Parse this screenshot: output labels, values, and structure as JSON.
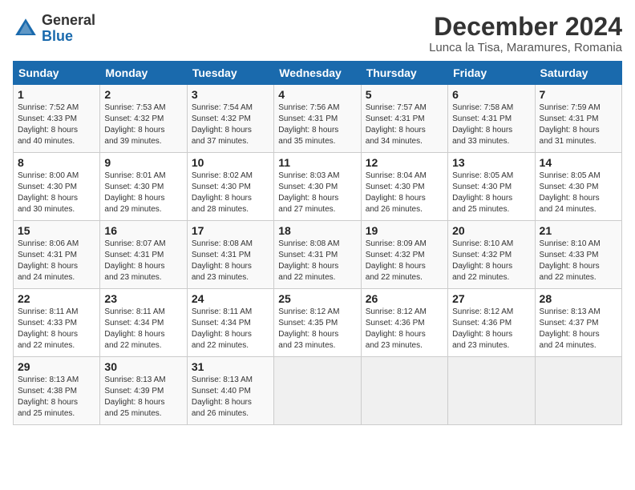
{
  "logo": {
    "general": "General",
    "blue": "Blue"
  },
  "title": "December 2024",
  "location": "Lunca la Tisa, Maramures, Romania",
  "days_of_week": [
    "Sunday",
    "Monday",
    "Tuesday",
    "Wednesday",
    "Thursday",
    "Friday",
    "Saturday"
  ],
  "weeks": [
    [
      {
        "day": "1",
        "info": "Sunrise: 7:52 AM\nSunset: 4:33 PM\nDaylight: 8 hours\nand 40 minutes."
      },
      {
        "day": "2",
        "info": "Sunrise: 7:53 AM\nSunset: 4:32 PM\nDaylight: 8 hours\nand 39 minutes."
      },
      {
        "day": "3",
        "info": "Sunrise: 7:54 AM\nSunset: 4:32 PM\nDaylight: 8 hours\nand 37 minutes."
      },
      {
        "day": "4",
        "info": "Sunrise: 7:56 AM\nSunset: 4:31 PM\nDaylight: 8 hours\nand 35 minutes."
      },
      {
        "day": "5",
        "info": "Sunrise: 7:57 AM\nSunset: 4:31 PM\nDaylight: 8 hours\nand 34 minutes."
      },
      {
        "day": "6",
        "info": "Sunrise: 7:58 AM\nSunset: 4:31 PM\nDaylight: 8 hours\nand 33 minutes."
      },
      {
        "day": "7",
        "info": "Sunrise: 7:59 AM\nSunset: 4:31 PM\nDaylight: 8 hours\nand 31 minutes."
      }
    ],
    [
      {
        "day": "8",
        "info": "Sunrise: 8:00 AM\nSunset: 4:30 PM\nDaylight: 8 hours\nand 30 minutes."
      },
      {
        "day": "9",
        "info": "Sunrise: 8:01 AM\nSunset: 4:30 PM\nDaylight: 8 hours\nand 29 minutes."
      },
      {
        "day": "10",
        "info": "Sunrise: 8:02 AM\nSunset: 4:30 PM\nDaylight: 8 hours\nand 28 minutes."
      },
      {
        "day": "11",
        "info": "Sunrise: 8:03 AM\nSunset: 4:30 PM\nDaylight: 8 hours\nand 27 minutes."
      },
      {
        "day": "12",
        "info": "Sunrise: 8:04 AM\nSunset: 4:30 PM\nDaylight: 8 hours\nand 26 minutes."
      },
      {
        "day": "13",
        "info": "Sunrise: 8:05 AM\nSunset: 4:30 PM\nDaylight: 8 hours\nand 25 minutes."
      },
      {
        "day": "14",
        "info": "Sunrise: 8:05 AM\nSunset: 4:30 PM\nDaylight: 8 hours\nand 24 minutes."
      }
    ],
    [
      {
        "day": "15",
        "info": "Sunrise: 8:06 AM\nSunset: 4:31 PM\nDaylight: 8 hours\nand 24 minutes."
      },
      {
        "day": "16",
        "info": "Sunrise: 8:07 AM\nSunset: 4:31 PM\nDaylight: 8 hours\nand 23 minutes."
      },
      {
        "day": "17",
        "info": "Sunrise: 8:08 AM\nSunset: 4:31 PM\nDaylight: 8 hours\nand 23 minutes."
      },
      {
        "day": "18",
        "info": "Sunrise: 8:08 AM\nSunset: 4:31 PM\nDaylight: 8 hours\nand 22 minutes."
      },
      {
        "day": "19",
        "info": "Sunrise: 8:09 AM\nSunset: 4:32 PM\nDaylight: 8 hours\nand 22 minutes."
      },
      {
        "day": "20",
        "info": "Sunrise: 8:10 AM\nSunset: 4:32 PM\nDaylight: 8 hours\nand 22 minutes."
      },
      {
        "day": "21",
        "info": "Sunrise: 8:10 AM\nSunset: 4:33 PM\nDaylight: 8 hours\nand 22 minutes."
      }
    ],
    [
      {
        "day": "22",
        "info": "Sunrise: 8:11 AM\nSunset: 4:33 PM\nDaylight: 8 hours\nand 22 minutes."
      },
      {
        "day": "23",
        "info": "Sunrise: 8:11 AM\nSunset: 4:34 PM\nDaylight: 8 hours\nand 22 minutes."
      },
      {
        "day": "24",
        "info": "Sunrise: 8:11 AM\nSunset: 4:34 PM\nDaylight: 8 hours\nand 22 minutes."
      },
      {
        "day": "25",
        "info": "Sunrise: 8:12 AM\nSunset: 4:35 PM\nDaylight: 8 hours\nand 23 minutes."
      },
      {
        "day": "26",
        "info": "Sunrise: 8:12 AM\nSunset: 4:36 PM\nDaylight: 8 hours\nand 23 minutes."
      },
      {
        "day": "27",
        "info": "Sunrise: 8:12 AM\nSunset: 4:36 PM\nDaylight: 8 hours\nand 23 minutes."
      },
      {
        "day": "28",
        "info": "Sunrise: 8:13 AM\nSunset: 4:37 PM\nDaylight: 8 hours\nand 24 minutes."
      }
    ],
    [
      {
        "day": "29",
        "info": "Sunrise: 8:13 AM\nSunset: 4:38 PM\nDaylight: 8 hours\nand 25 minutes."
      },
      {
        "day": "30",
        "info": "Sunrise: 8:13 AM\nSunset: 4:39 PM\nDaylight: 8 hours\nand 25 minutes."
      },
      {
        "day": "31",
        "info": "Sunrise: 8:13 AM\nSunset: 4:40 PM\nDaylight: 8 hours\nand 26 minutes."
      },
      {
        "day": "",
        "info": ""
      },
      {
        "day": "",
        "info": ""
      },
      {
        "day": "",
        "info": ""
      },
      {
        "day": "",
        "info": ""
      }
    ]
  ]
}
